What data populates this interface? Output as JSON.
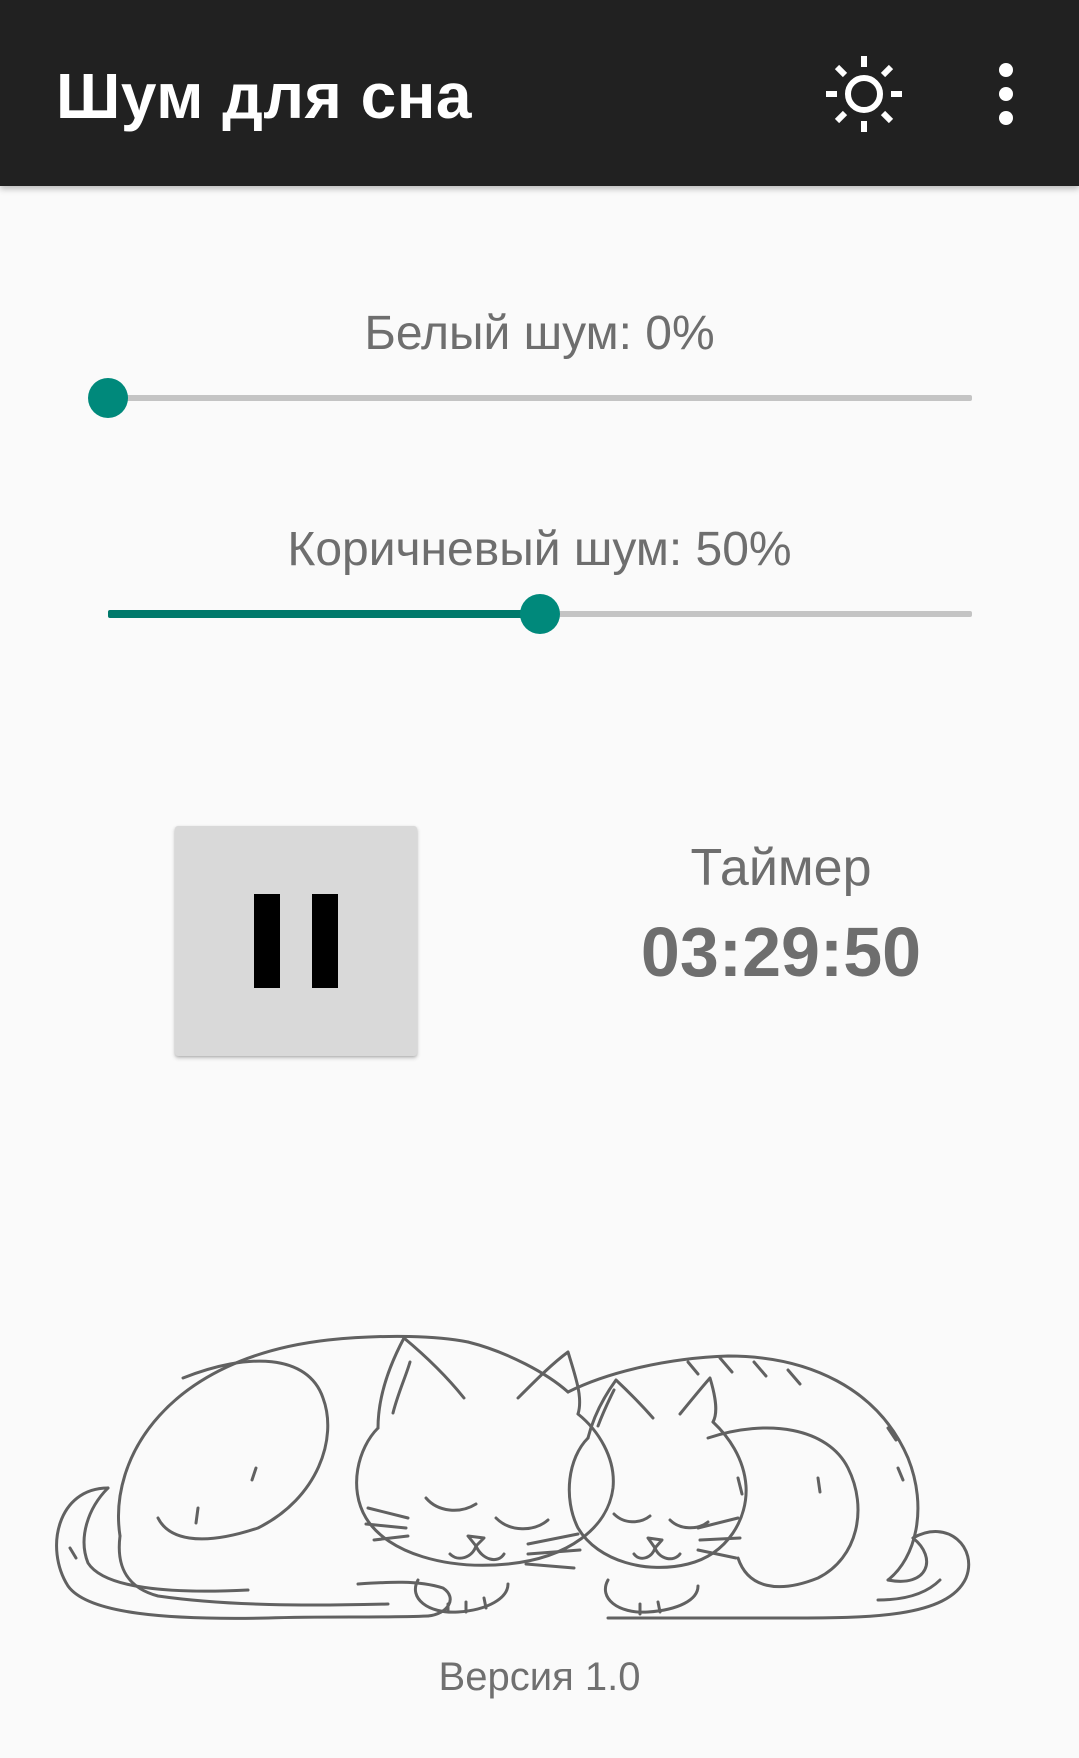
{
  "app_bar": {
    "title": "Шум для сна",
    "theme_icon": "brightness-sun-icon",
    "menu_icon": "more-vert-icon",
    "background_color": "#212121"
  },
  "white_noise": {
    "label": "Белый шум: 0%",
    "value_percent": 0
  },
  "brown_noise": {
    "label": "Коричневый шум: 50%",
    "value_percent": 50
  },
  "playback": {
    "icon": "pause-icon"
  },
  "timer": {
    "label": "Таймер",
    "value": "03:29:50"
  },
  "illustration": {
    "icon": "sleeping-cats-illustration"
  },
  "footer": {
    "version": "Версия 1.0"
  },
  "colors": {
    "accent": "#00897b",
    "track": "#c4c4c4",
    "text": "#6e6e6e"
  }
}
